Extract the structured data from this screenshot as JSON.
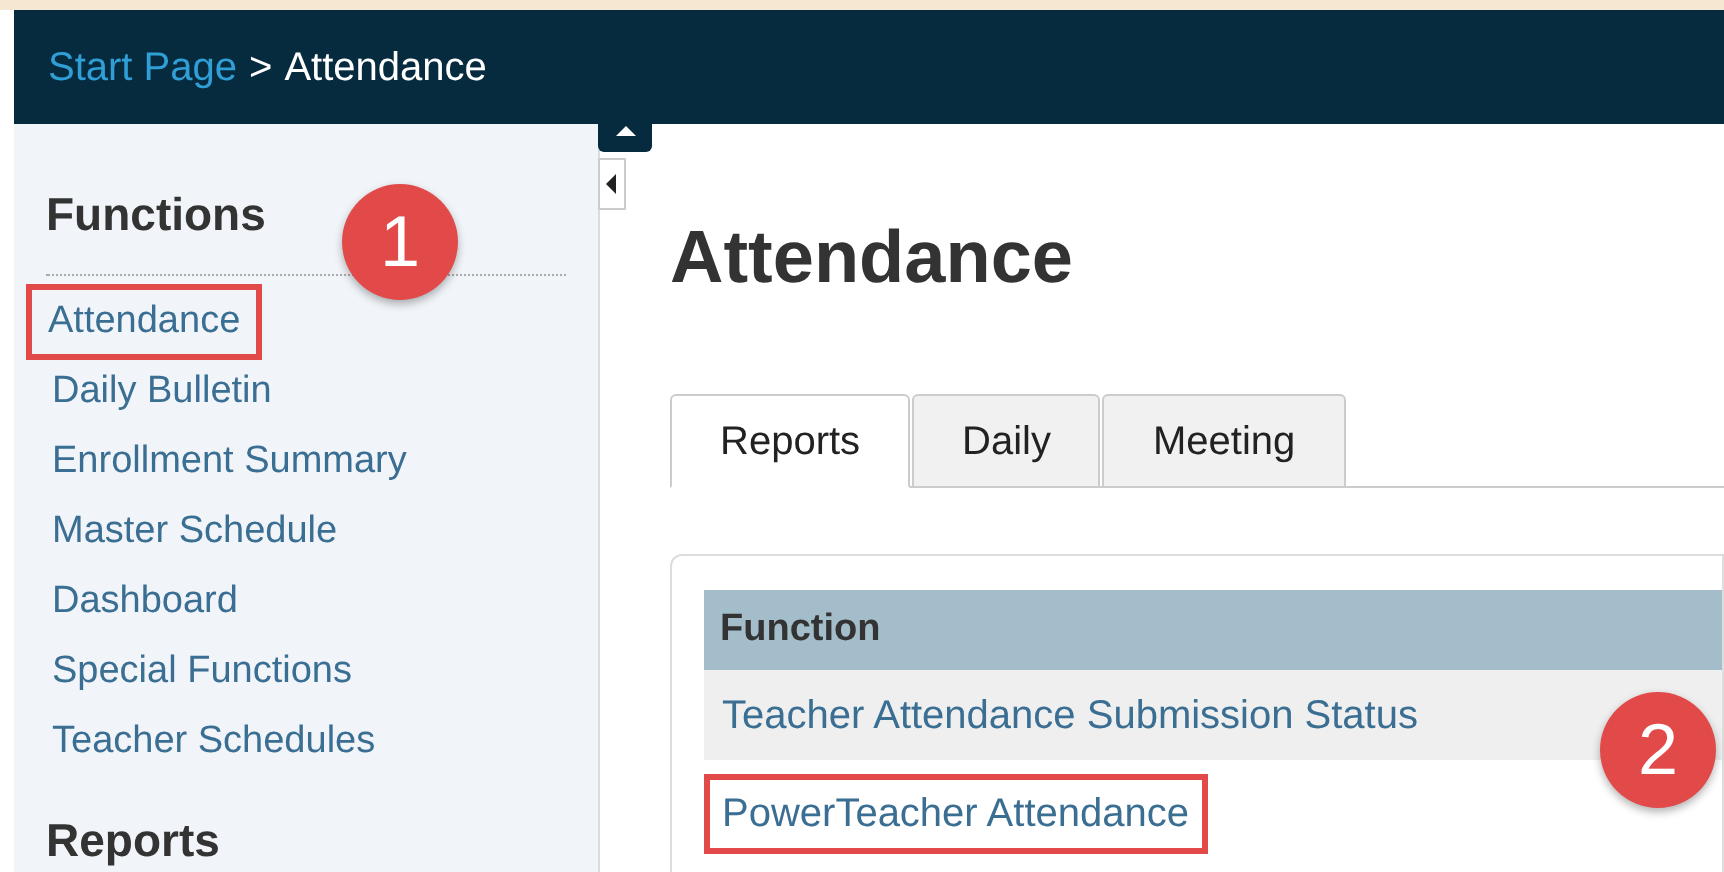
{
  "breadcrumb": {
    "link": "Start Page",
    "separator": ">",
    "current": "Attendance"
  },
  "sidebar": {
    "sections": [
      {
        "heading": "Functions",
        "items": [
          {
            "label": "Attendance",
            "boxed": true,
            "badge": "1"
          },
          {
            "label": "Daily Bulletin",
            "boxed": false
          },
          {
            "label": "Enrollment Summary",
            "boxed": false
          },
          {
            "label": "Master Schedule",
            "boxed": false
          },
          {
            "label": "Dashboard",
            "boxed": false
          },
          {
            "label": "Special Functions",
            "boxed": false
          },
          {
            "label": "Teacher Schedules",
            "boxed": false
          }
        ]
      },
      {
        "heading": "Reports"
      }
    ]
  },
  "page_title": "Attendance",
  "tabs": [
    {
      "label": "Reports",
      "selected": true
    },
    {
      "label": "Daily",
      "selected": false
    },
    {
      "label": "Meeting",
      "selected": false
    }
  ],
  "table": {
    "columns": [
      "Function"
    ],
    "rows": [
      {
        "cells": [
          "Teacher Attendance Submission Status"
        ],
        "boxed": false
      },
      {
        "cells": [
          "PowerTeacher Attendance"
        ],
        "boxed": true,
        "badge": "2"
      }
    ]
  }
}
